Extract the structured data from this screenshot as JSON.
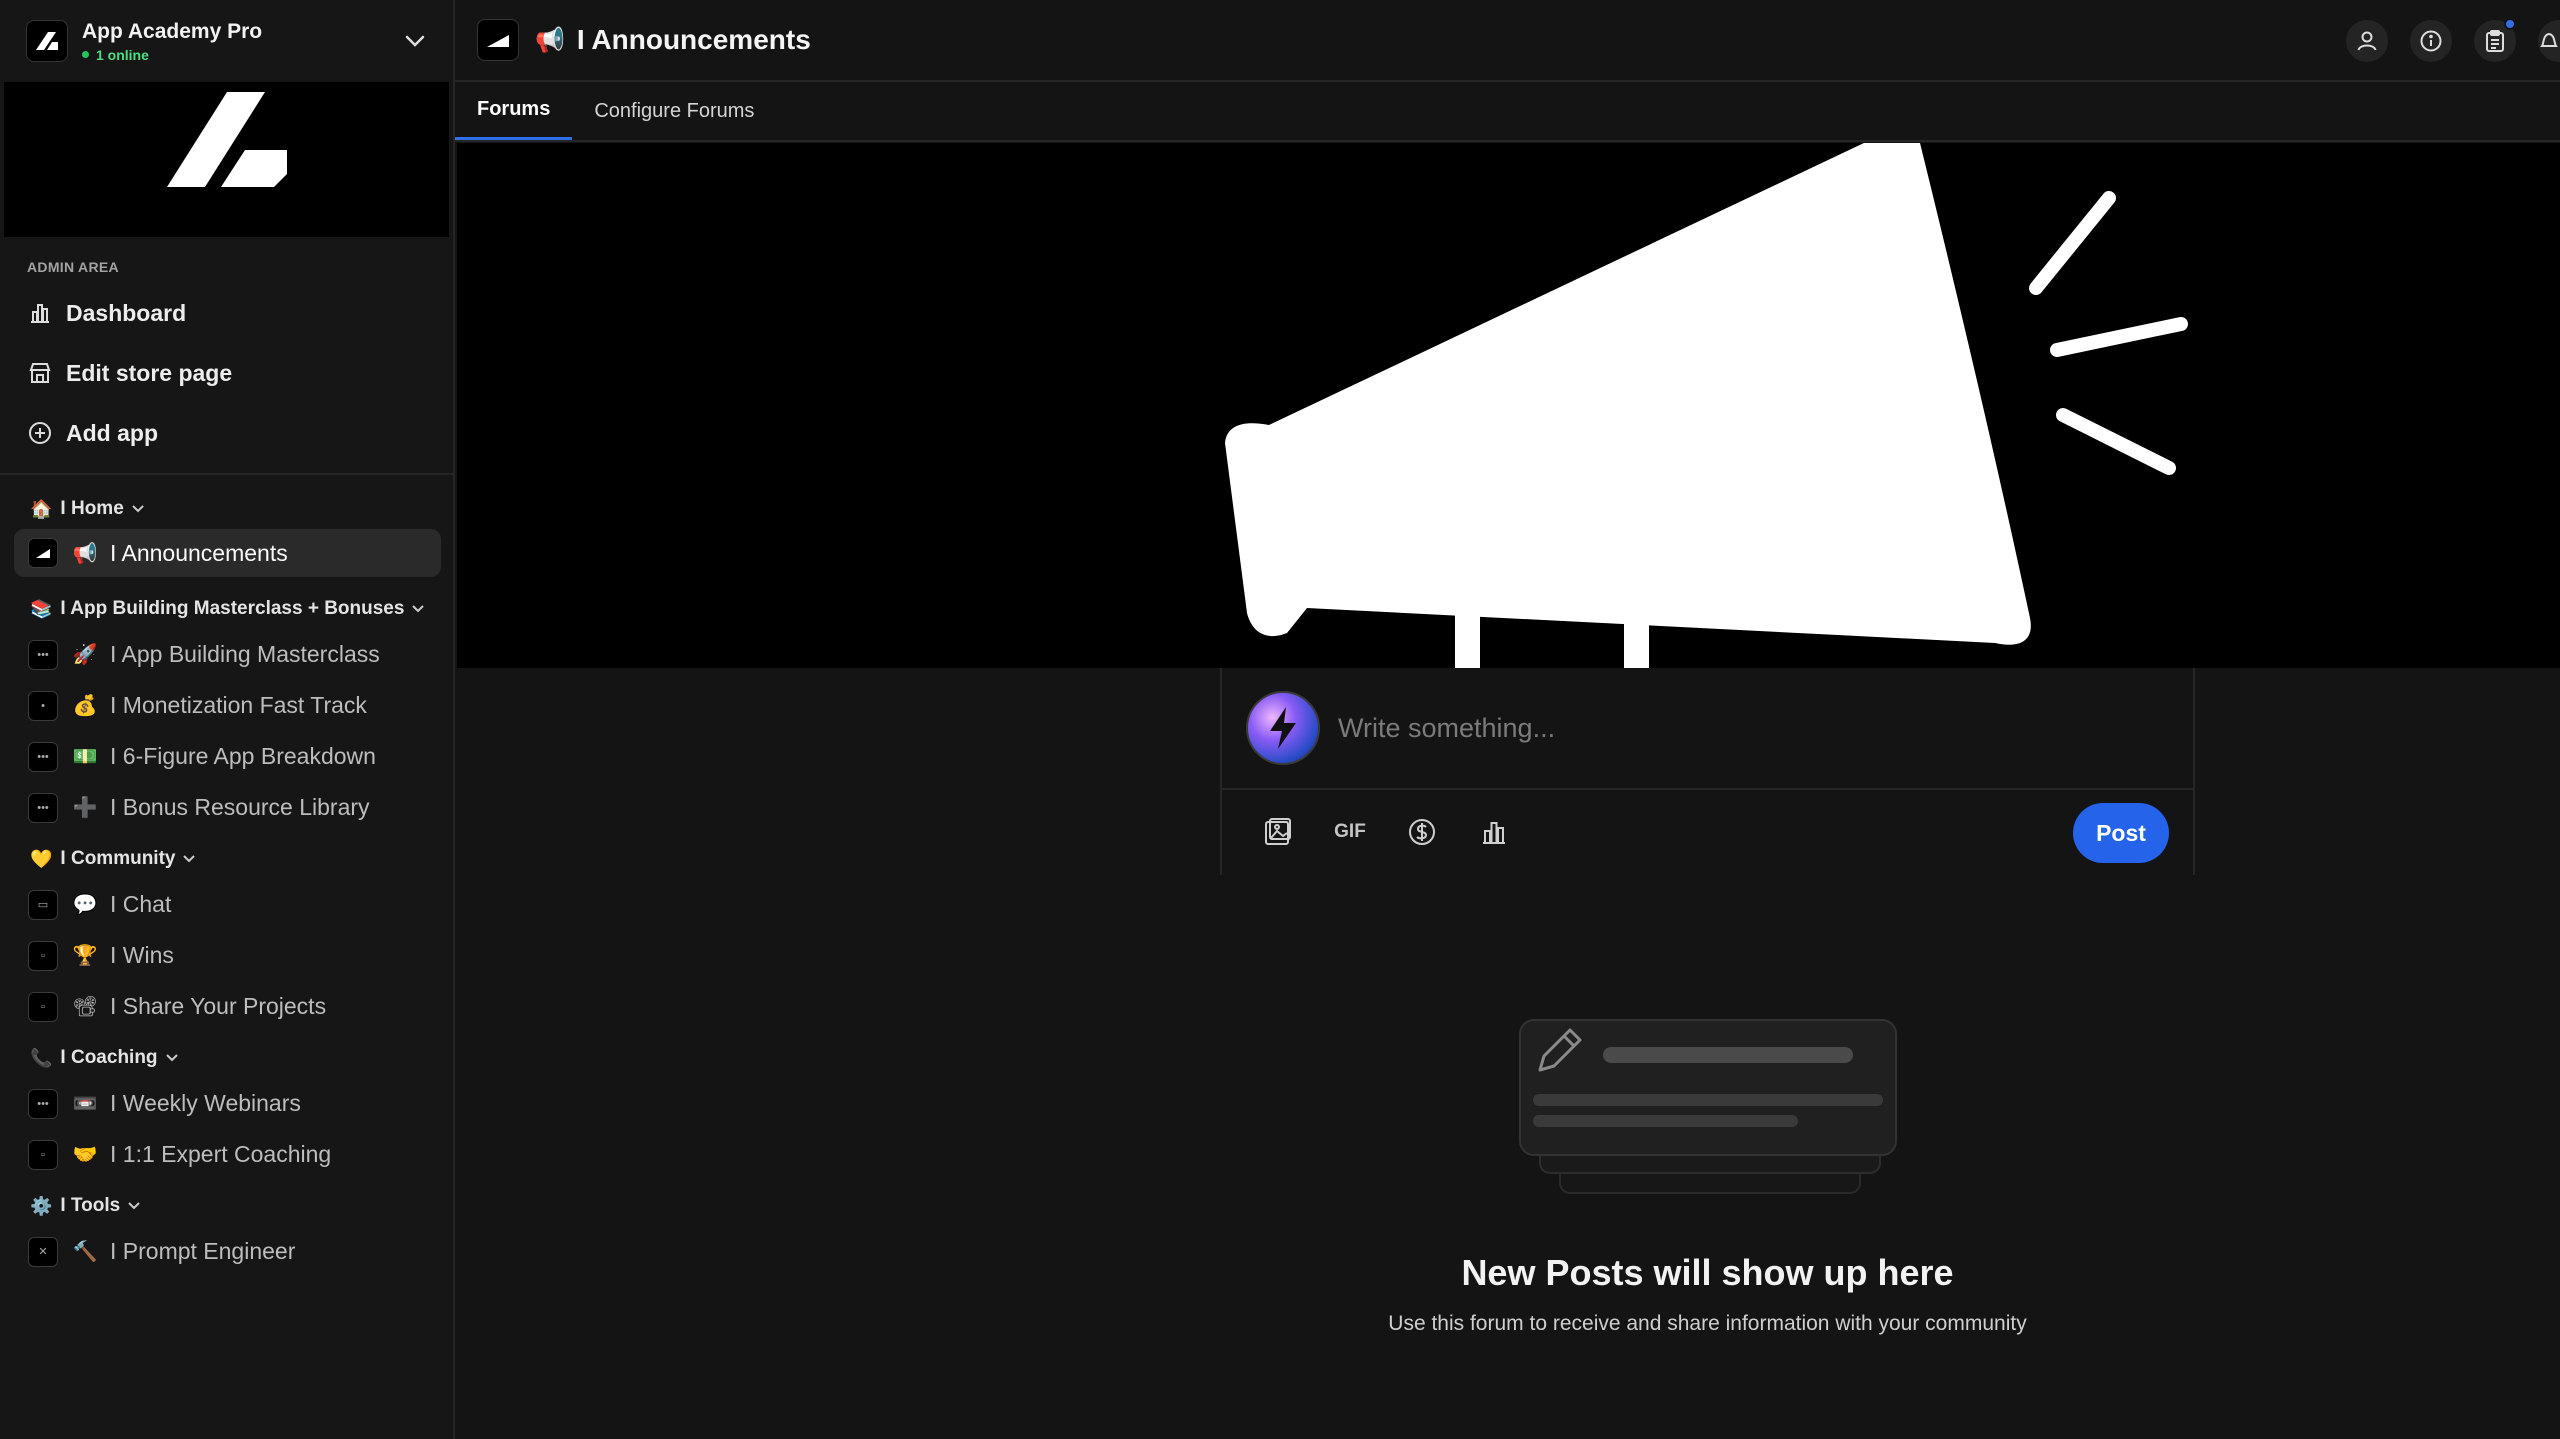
{
  "workspace": {
    "name": "App Academy Pro",
    "online": "1 online"
  },
  "admin": {
    "label": "ADMIN AREA",
    "items": [
      {
        "label": "Dashboard",
        "icon": "bar-chart-icon"
      },
      {
        "label": "Edit store page",
        "icon": "store-icon"
      },
      {
        "label": "Add app",
        "icon": "plus-circle-icon"
      }
    ]
  },
  "groups": [
    {
      "emoji": "🏠",
      "label": "I Home",
      "channels": [
        {
          "thumb": "",
          "emoji": "📢",
          "label": "I Announcements",
          "active": true
        }
      ]
    },
    {
      "emoji": "📚",
      "label": "I App Building Masterclass + Bonuses",
      "channels": [
        {
          "thumb": "•••",
          "emoji": "🚀",
          "label": "I App Building Masterclass"
        },
        {
          "thumb": "•",
          "emoji": "💰",
          "label": "I Monetization Fast Track"
        },
        {
          "thumb": "•••",
          "emoji": "💵",
          "label": "I 6-Figure App Breakdown"
        },
        {
          "thumb": "•••",
          "emoji": "➕",
          "label": "I Bonus Resource Library"
        }
      ]
    },
    {
      "emoji": "💛",
      "label": "I Community",
      "channels": [
        {
          "thumb": "▭",
          "emoji": "💬",
          "label": "I Chat"
        },
        {
          "thumb": "▫",
          "emoji": "🏆",
          "label": "I Wins"
        },
        {
          "thumb": "▫",
          "emoji": "📽",
          "label": "I Share Your Projects"
        }
      ]
    },
    {
      "emoji": "📞",
      "label": "I Coaching",
      "channels": [
        {
          "thumb": "•••",
          "emoji": "📼",
          "label": "I Weekly Webinars"
        },
        {
          "thumb": "▫",
          "emoji": "🤝",
          "label": "I 1:1 Expert Coaching"
        }
      ]
    },
    {
      "emoji": "⚙️",
      "label": "I Tools",
      "channels": [
        {
          "thumb": "✕",
          "emoji": "🔨",
          "label": "I Prompt Engineer"
        }
      ]
    }
  ],
  "header": {
    "emoji": "📢",
    "title": "I Announcements",
    "icons": [
      "user-icon",
      "info-icon",
      "clipboard-icon",
      "bell-icon"
    ]
  },
  "tabs": [
    {
      "label": "Forums",
      "active": true
    },
    {
      "label": "Configure Forums",
      "active": false
    }
  ],
  "composer": {
    "placeholder": "Write something...",
    "tools": [
      "image-icon",
      "GIF",
      "dollar-icon",
      "poll-icon"
    ],
    "post_label": "Post"
  },
  "empty_state": {
    "title": "New Posts will show up here",
    "subtitle": "Use this forum to receive and share information with your community"
  },
  "colors": {
    "accent": "#2563eb",
    "online": "#22c55e",
    "background": "#141414"
  }
}
